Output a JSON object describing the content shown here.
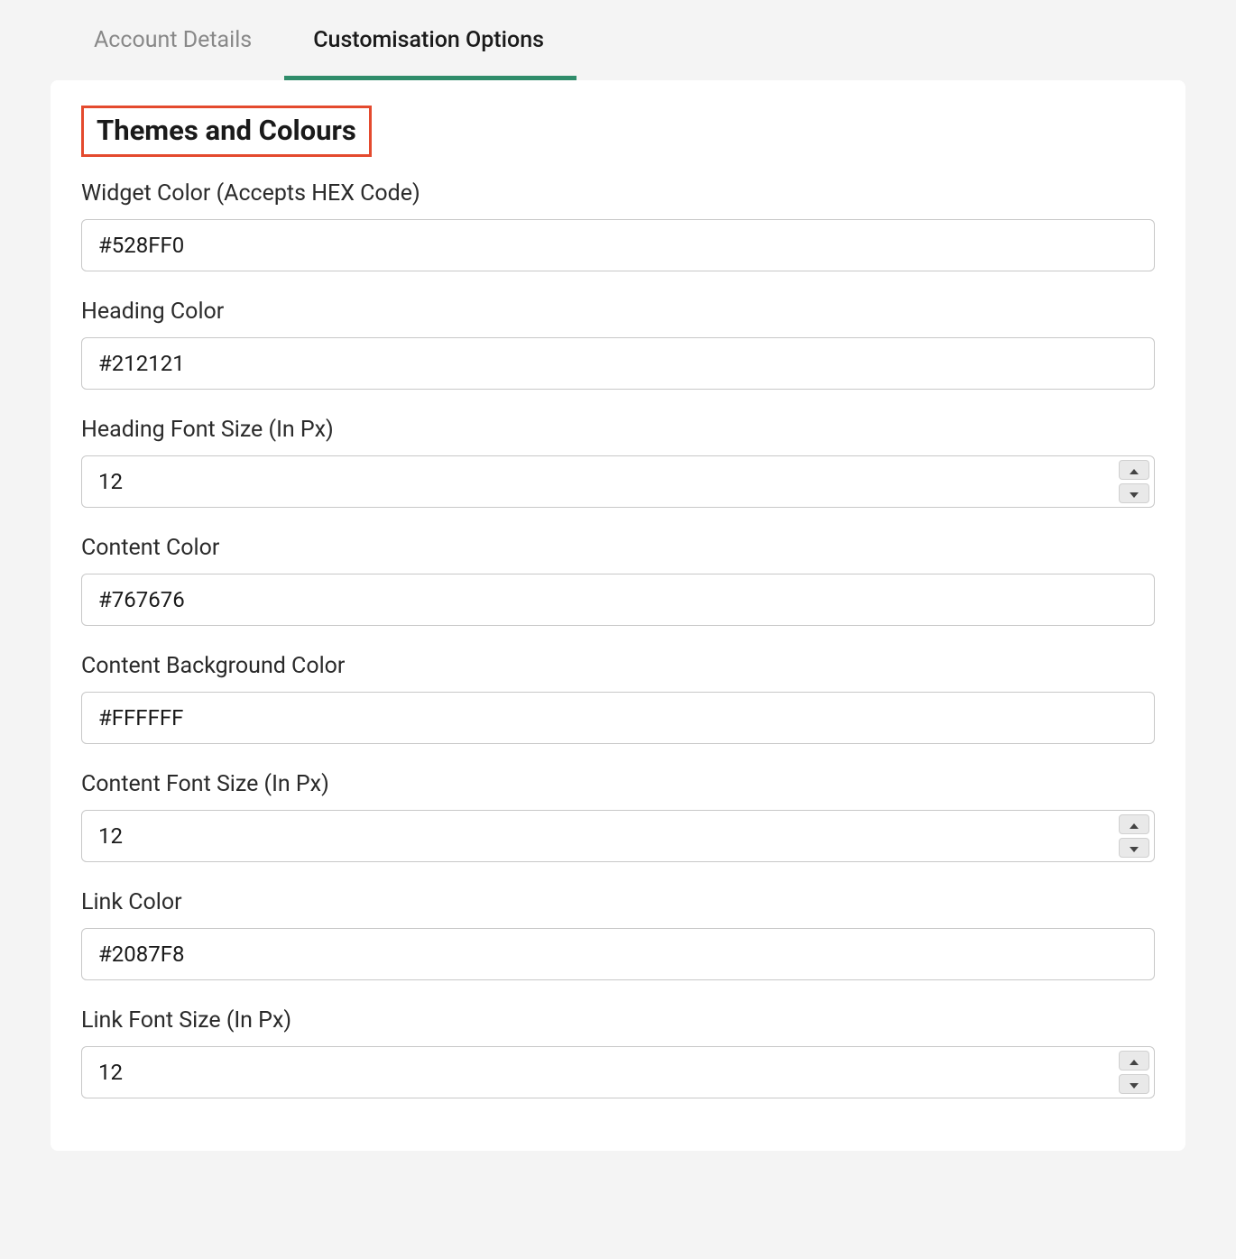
{
  "tabs": {
    "account_details": "Account Details",
    "customisation_options": "Customisation Options"
  },
  "section": {
    "title": "Themes and Colours"
  },
  "fields": {
    "widget_color": {
      "label": "Widget Color (Accepts HEX Code)",
      "value": "#528FF0"
    },
    "heading_color": {
      "label": "Heading Color",
      "value": "#212121"
    },
    "heading_font_size": {
      "label": "Heading Font Size (In Px)",
      "value": "12"
    },
    "content_color": {
      "label": "Content Color",
      "value": "#767676"
    },
    "content_bg_color": {
      "label": "Content Background Color",
      "value": "#FFFFFF"
    },
    "content_font_size": {
      "label": "Content Font Size (In Px)",
      "value": "12"
    },
    "link_color": {
      "label": "Link Color",
      "value": "#2087F8"
    },
    "link_font_size": {
      "label": "Link Font Size (In Px)",
      "value": "12"
    }
  }
}
